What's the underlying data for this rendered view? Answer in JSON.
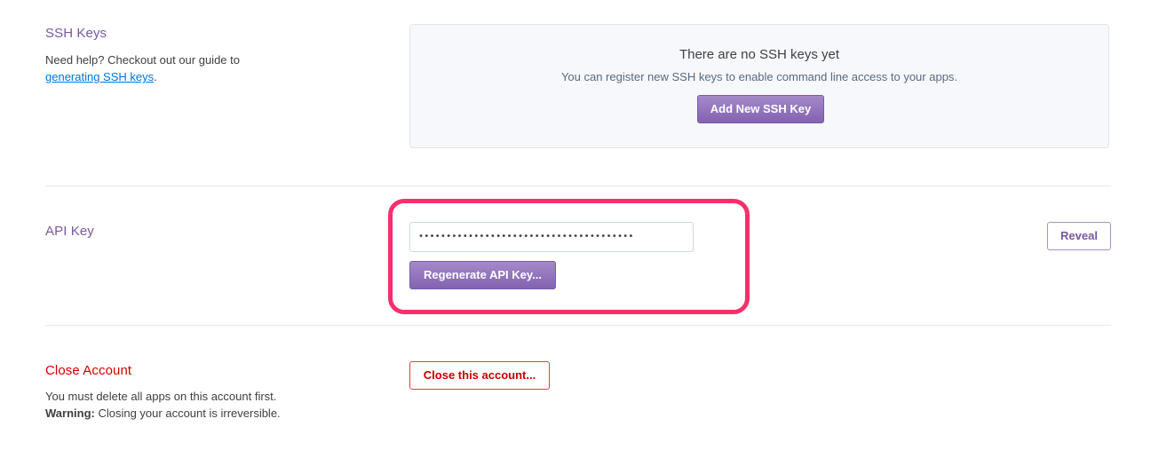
{
  "ssh": {
    "title": "SSH Keys",
    "help_prefix": "Need help? Checkout out our guide to",
    "help_link": "generating SSH keys",
    "help_suffix": ".",
    "empty_title": "There are no SSH keys yet",
    "empty_subtitle": "You can register new SSH keys to enable command line access to your apps.",
    "add_button": "Add New SSH Key"
  },
  "api_key": {
    "title": "API Key",
    "masked_value": "•••••••••••••••••••••••••••••••••••••••",
    "regenerate_button": "Regenerate API Key...",
    "reveal_button": "Reveal"
  },
  "close_account": {
    "title": "Close Account",
    "note": "You must delete all apps on this account first.",
    "warning_label": "Warning:",
    "warning_text": "Closing your account is irreversible.",
    "button": "Close this account..."
  },
  "colors": {
    "accent": "#79589f",
    "danger": "#d20000",
    "highlight": "#f5306c"
  }
}
